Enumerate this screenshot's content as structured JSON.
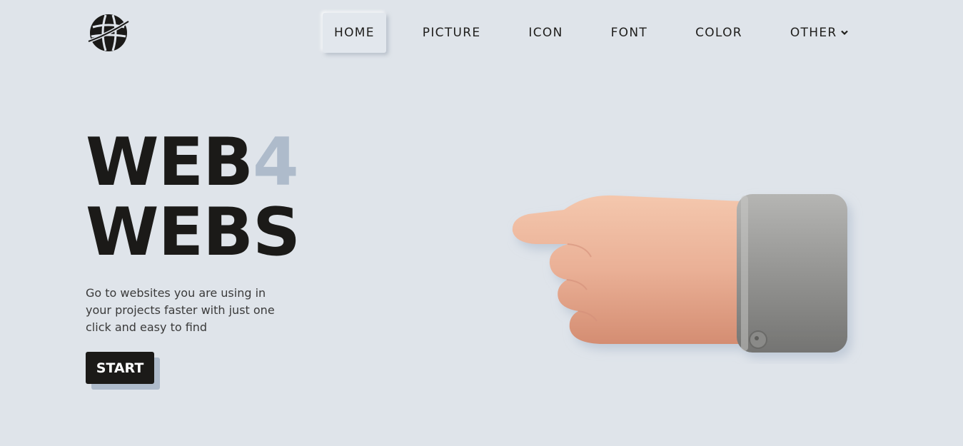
{
  "header": {
    "logo_icon": "globe-logo-icon",
    "nav": [
      {
        "label": "HOME",
        "active": true
      },
      {
        "label": "PICTURE",
        "active": false
      },
      {
        "label": "ICON",
        "active": false
      },
      {
        "label": "FONT",
        "active": false
      },
      {
        "label": "COLOR",
        "active": false
      },
      {
        "label": "OTHER",
        "active": false,
        "has_dropdown": true
      }
    ]
  },
  "hero": {
    "title_part1": "WEB",
    "title_accent": "4",
    "title_line2": "WEBS",
    "description": "Go to websites you are using in your projects faster with just one click and easy to find",
    "start_label": "START",
    "illustration": "pointing-hand-illustration"
  },
  "colors": {
    "background": "#dfe4ea",
    "text": "#1b1a18",
    "accent": "#aebbcb"
  }
}
